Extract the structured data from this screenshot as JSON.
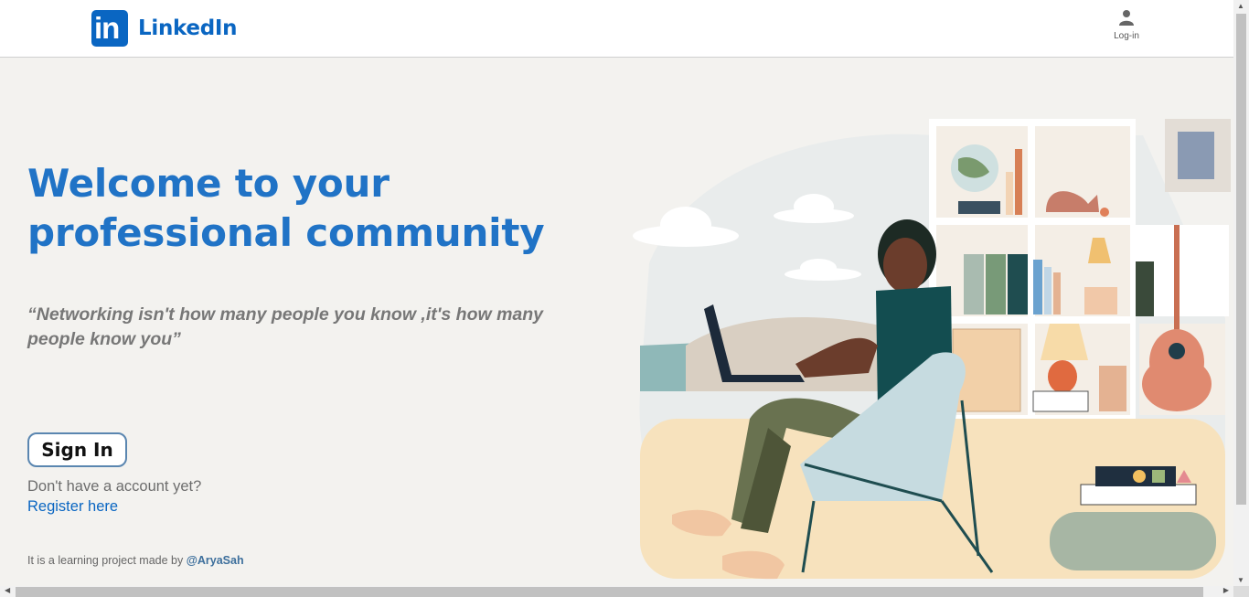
{
  "header": {
    "logo_mark": "in",
    "logo_text": "LinkedIn",
    "login_label": "Log-in",
    "login_icon": "user-icon"
  },
  "hero": {
    "title_line1": "Welcome to your",
    "title_line2": "professional community",
    "quote": "“Networking isn't how many people you know ,it's how many people know you”"
  },
  "auth": {
    "signin_label": "Sign In",
    "no_account_text": "Don't have a account yet?",
    "register_link": "Register here"
  },
  "footer": {
    "note_prefix": "It is a learning project made by ",
    "author_handle": "@AryaSah"
  },
  "colors": {
    "brand": "#0a66c2",
    "background": "#f3f2ef",
    "text_muted": "#777777"
  }
}
